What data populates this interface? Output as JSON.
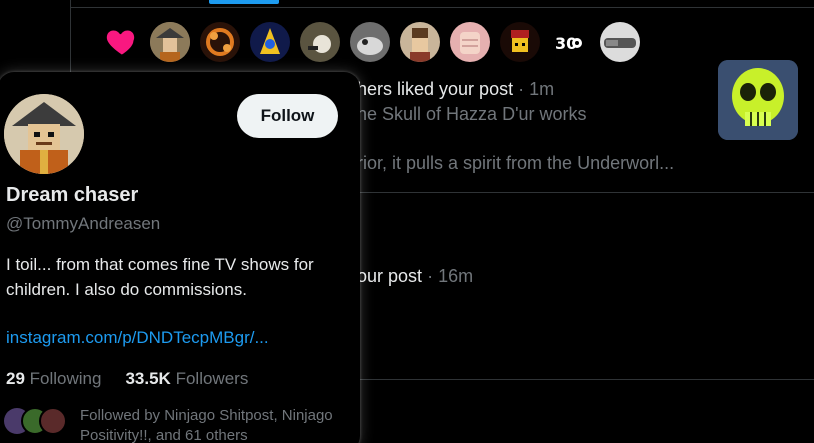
{
  "notifications": {
    "avatar_row": [
      "avatar-1",
      "avatar-2",
      "avatar-3",
      "avatar-4",
      "avatar-5",
      "avatar-6",
      "avatar-7",
      "avatar-8",
      "avatar-9",
      "avatar-10"
    ],
    "first": {
      "action_text": "hers liked your post",
      "time": "1m",
      "post_title": "he Skull of Hazza D'ur works",
      "post_excerpt": "rior, it pulls a spirit from the Underworl..."
    },
    "second": {
      "action_text": "our post",
      "time": "16m"
    },
    "separator": "·"
  },
  "hover_card": {
    "display_name": "Dream chaser",
    "handle": "@TommyAndreasen",
    "follow_label": "Follow",
    "bio": "I toil... from that comes fine TV shows for children. I also do commissions.",
    "link": "instagram.com/p/DNDTecpMBgr/...",
    "following_count": "29",
    "following_label": "Following",
    "followers_count": "33.5K",
    "followers_label": "Followers",
    "followed_by": "Followed by Ninjago Shitpost, Ninjago Positivity!!, and 61 others"
  },
  "colors": {
    "accent": "#1d9bf0",
    "heart": "#f91880",
    "muted": "#71767b",
    "text": "#e7e9ea",
    "thumb_skull": "#c8f02a"
  }
}
